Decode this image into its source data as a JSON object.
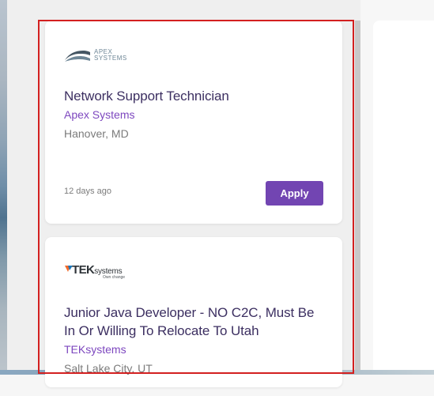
{
  "jobs": [
    {
      "logo": {
        "name": "apex-systems-logo",
        "text_line_1": "APEX",
        "text_line_2": "SYSTEMS",
        "icon": "apex-logo-icon"
      },
      "title": "Network Support Technician",
      "company": "Apex Systems",
      "location": "Hanover, MD",
      "posted": "12 days ago",
      "apply_label": "Apply"
    },
    {
      "logo": {
        "name": "teksystems-logo",
        "brand_bold": "TEK",
        "brand_light": "systems",
        "tagline": "Own change",
        "icon": "teksystems-logo-icon"
      },
      "title": "Junior Java Developer - NO C2C, Must Be In Or Willing To Relocate To Utah",
      "company": "TEKsystems",
      "location": "Salt Lake City, UT"
    }
  ],
  "colors": {
    "title": "#3c2f61",
    "company": "#7d47bf",
    "location": "#7b7b7b",
    "button": "#7245b2",
    "outline": "#d32020"
  }
}
